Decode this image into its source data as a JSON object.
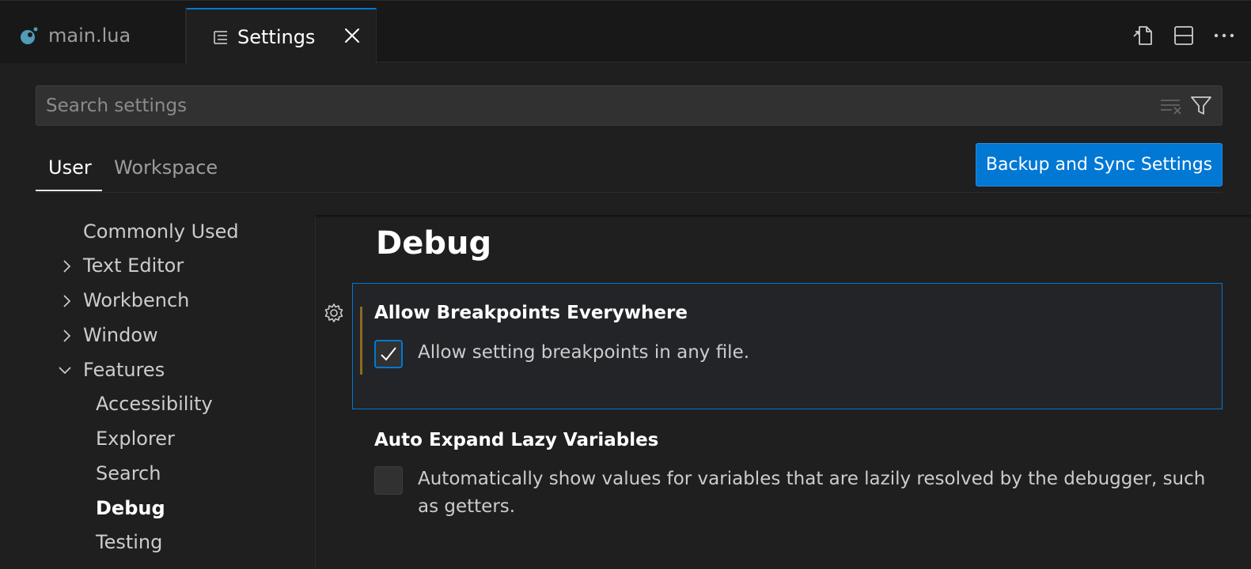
{
  "tabs": [
    {
      "label": "main.lua",
      "icon": "lua-file-icon",
      "active": false
    },
    {
      "label": "Settings",
      "icon": "settings-editor-icon",
      "active": true
    }
  ],
  "editor_actions": [
    "open-settings-json-icon",
    "split-editor-icon",
    "more-actions-icon"
  ],
  "search": {
    "placeholder": "Search settings",
    "value": ""
  },
  "scopes": {
    "user": "User",
    "workspace": "Workspace",
    "selected": "User"
  },
  "sync_button": "Backup and Sync Settings",
  "toc": [
    {
      "label": "Commonly Used",
      "chevron": "none"
    },
    {
      "label": "Text Editor",
      "chevron": "collapsed"
    },
    {
      "label": "Workbench",
      "chevron": "collapsed"
    },
    {
      "label": "Window",
      "chevron": "collapsed"
    },
    {
      "label": "Features",
      "chevron": "expanded"
    },
    {
      "label": "Accessibility",
      "chevron": "none"
    },
    {
      "label": "Explorer",
      "chevron": "none"
    },
    {
      "label": "Search",
      "chevron": "none"
    },
    {
      "label": "Debug",
      "chevron": "none",
      "active": true
    },
    {
      "label": "Testing",
      "chevron": "none"
    }
  ],
  "section": {
    "title": "Debug"
  },
  "settings": [
    {
      "title": "Allow Breakpoints Everywhere",
      "description": "Allow setting breakpoints in any file.",
      "checked": true,
      "modified": true
    },
    {
      "title": "Auto Expand Lazy Variables",
      "description": "Automatically show values for variables that are lazily resolved by the debugger, such as getters.",
      "checked": false,
      "modified": false
    }
  ],
  "colors": {
    "accent": "#0078d4",
    "background": "#1f1f1f",
    "tabbar": "#181818",
    "modified": "#8b6b1f",
    "lua": "#519aba"
  }
}
